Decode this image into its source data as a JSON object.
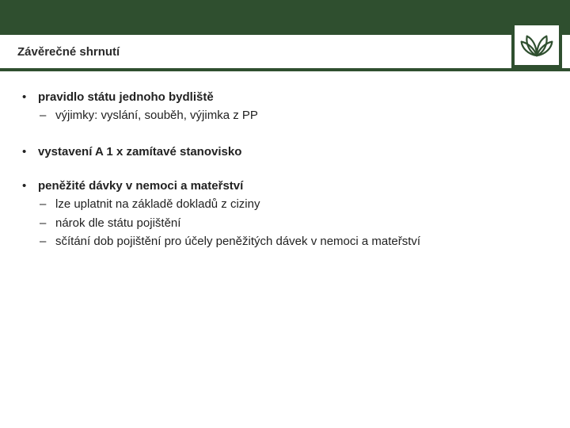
{
  "header": {
    "title": "Závěrečné shrnutí"
  },
  "logo": {
    "name": "lotus-icon"
  },
  "bullets": [
    {
      "text": "pravidlo státu jednoho bydliště",
      "bold": true,
      "sub": [
        "výjimky: vyslání, souběh, výjimka z PP"
      ]
    },
    {
      "text": "vystavení A 1 x zamítavé stanovisko",
      "bold": true,
      "sub": []
    },
    {
      "text": "peněžité dávky v nemoci a mateřství",
      "bold": true,
      "sub": [
        "lze uplatnit na základě dokladů z ciziny",
        "nárok dle státu pojištění",
        "sčítání dob pojištění pro účely peněžitých dávek v nemoci a mateřství"
      ]
    }
  ]
}
